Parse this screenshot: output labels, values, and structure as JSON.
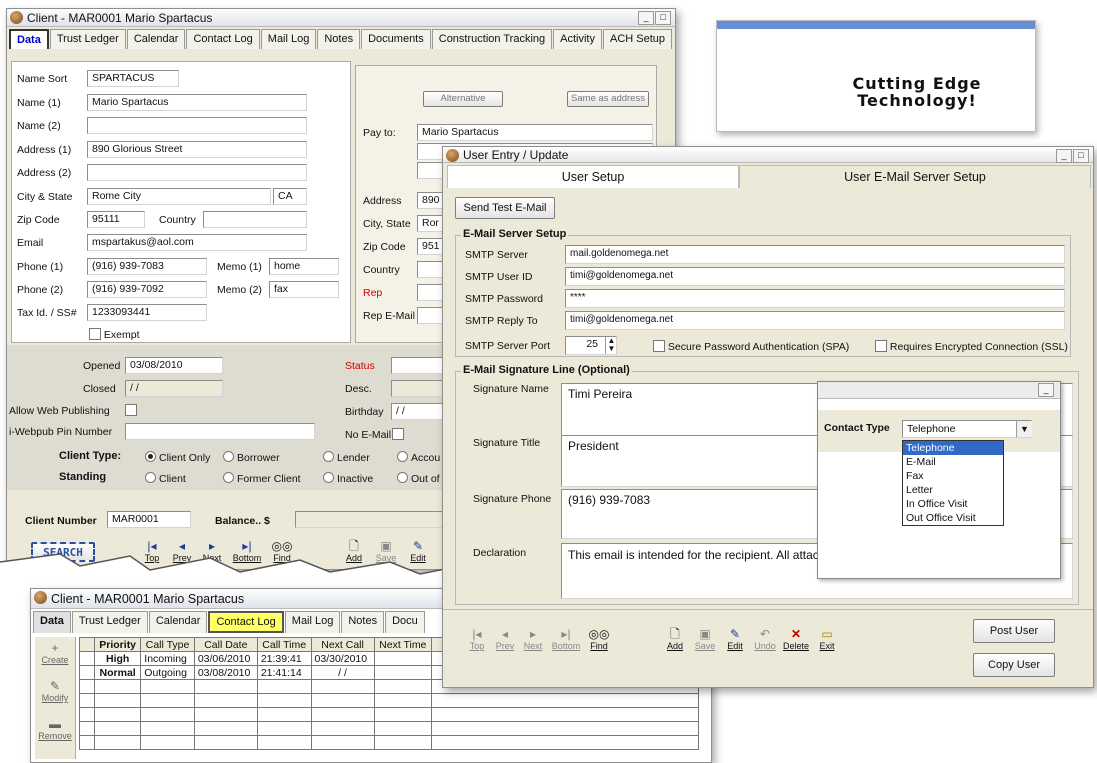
{
  "client_window": {
    "title": "Client - MAR0001 Mario Spartacus",
    "tabs": [
      "Data",
      "Trust Ledger",
      "Calendar",
      "Contact Log",
      "Mail Log",
      "Notes",
      "Documents",
      "Construction Tracking",
      "Activity",
      "ACH Setup"
    ],
    "fields": {
      "name_sort_label": "Name Sort",
      "name_sort": "SPARTACUS",
      "name1_label": "Name (1)",
      "name1": "Mario Spartacus",
      "name2_label": "Name (2)",
      "name2": "",
      "address1_label": "Address (1)",
      "address1": "890 Glorious Street",
      "address2_label": "Address (2)",
      "address2": "",
      "city_state_label": "City & State",
      "city": "Rome City",
      "state": "CA",
      "zip_label": "Zip Code",
      "zip": "95111",
      "country_label": "Country",
      "country": "",
      "email_label": "Email",
      "email": "mspartakus@aol.com",
      "phone1_label": "Phone (1)",
      "phone1": "(916) 939-7083",
      "memo1_label": "Memo (1)",
      "memo1": "home",
      "phone2_label": "Phone (2)",
      "phone2": "(916) 939-7092",
      "memo2_label": "Memo (2)",
      "memo2": "fax",
      "taxid_label": "Tax Id. / SS#",
      "taxid": "1233093441",
      "exempt_label": "Exempt"
    },
    "payto": {
      "alternative_btn": "Alternative",
      "same_btn": "Same as address",
      "pay_to_label": "Pay to:",
      "pay_to": "Mario Spartacus",
      "address_label": "Address",
      "address": "890",
      "city_state_label": "City, State",
      "city_state": "Ror",
      "zip_label": "Zip Code",
      "zip": "951",
      "country_label": "Country",
      "rep_label": "Rep",
      "rep_email_label": "Rep E-Mail"
    },
    "status": {
      "opened_label": "Opened",
      "opened": "03/08/2010",
      "closed_label": "Closed",
      "closed": " / /",
      "status_label": "Status",
      "desc_label": "Desc.",
      "birthday_label": "Birthday",
      "birthday": " / /",
      "web_publishing_label": "Allow Web Publishing",
      "webpub_pin_label": "i-Webpub Pin Number",
      "no_email_label": "No E-Mail",
      "client_type_label": "Client Type:",
      "client_types": [
        "Client Only",
        "Borrower",
        "Lender",
        "Accou"
      ],
      "standing_label": "Standing",
      "standings": [
        "Client",
        "Former Client",
        "Inactive",
        "Out of"
      ]
    },
    "bottom": {
      "client_number_label": "Client Number",
      "client_number": "MAR0001",
      "balance_label": "Balance.. $",
      "search_btn": "SEARCH",
      "nav": [
        "Top",
        "Prev",
        "Next",
        "Bottom",
        "Find"
      ],
      "actions": [
        "Add",
        "Save",
        "Edit"
      ]
    }
  },
  "ad_panel": {
    "text_line1": "Cutting Edge",
    "text_line2": "Technology!"
  },
  "user_window": {
    "title": "User Entry / Update",
    "tabs": [
      "User Setup",
      "User E-Mail Server Setup"
    ],
    "send_test_btn": "Send Test E-Mail",
    "server_group": "E-Mail Server Setup",
    "rows": [
      {
        "label": "SMTP Server",
        "value": "mail.goldenomega.net"
      },
      {
        "label": "SMTP User ID",
        "value": "timi@goldenomega.net"
      },
      {
        "label": "SMTP Password",
        "value": "****"
      },
      {
        "label": "SMTP Reply To",
        "value": "timi@goldenomega.net"
      }
    ],
    "port_label": "SMTP Server Port",
    "port": "25",
    "spa_label": "Secure Password Authentication (SPA)",
    "ssl_label": "Requires Encrypted Connection (SSL)",
    "signature_group": "E-Mail Signature Line (Optional)",
    "sig_name_label": "Signature Name",
    "sig_name": "Timi Pereira",
    "sig_title_label": "Signature Title",
    "sig_title": "President",
    "sig_phone_label": "Signature Phone",
    "sig_phone": "(916) 939-7083",
    "declaration_label": "Declaration",
    "declaration": "This email is intended for the recipient. All attac information for the recipient only.",
    "post_btn": "Post User",
    "copy_btn": "Copy User",
    "nav": [
      "Top",
      "Prev",
      "Next",
      "Bottom",
      "Find"
    ],
    "actions": [
      "Add",
      "Save",
      "Edit",
      "Undo",
      "Delete",
      "Exit"
    ]
  },
  "contact_type_popup": {
    "label": "Contact Type",
    "selected": "Telephone",
    "options": [
      "Telephone",
      "E-Mail",
      "Fax",
      "Letter",
      "In Office Visit",
      "Out Office Visit"
    ]
  },
  "contact_window": {
    "title": "Client - MAR0001 Mario Spartacus",
    "tabs": [
      "Data",
      "Trust Ledger",
      "Calendar",
      "Contact Log",
      "Mail Log",
      "Notes",
      "Docu"
    ],
    "side_buttons": [
      "Create",
      "Modify",
      "Remove"
    ],
    "columns": [
      "Priority",
      "Call Type",
      "Call Date",
      "Call Time",
      "Next Call",
      "Next Time"
    ],
    "rows": [
      [
        "High",
        "Incoming",
        "03/06/2010",
        "21:39:41",
        "03/30/2010",
        ""
      ],
      [
        "Normal",
        "Outgoing",
        "03/08/2010",
        "21:41:14",
        " / /",
        ""
      ]
    ]
  }
}
